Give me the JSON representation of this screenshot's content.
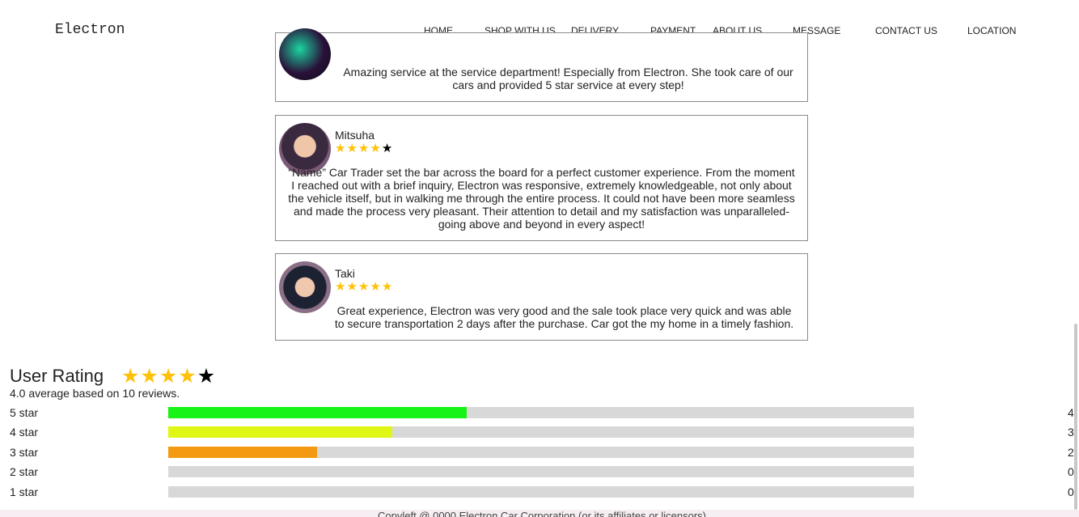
{
  "brand": "Electron",
  "nav": [
    "HOME",
    "SHOP WITH US",
    "DELIVERY",
    "PAYMENT",
    "ABOUT US",
    "MESSAGE",
    "CONTACT US",
    "LOCATION"
  ],
  "reviews": [
    {
      "name": "",
      "stars": null,
      "text": "Amazing service at the service department! Especially from Electron. She took care of our cars and provided 5 star service at every step!"
    },
    {
      "name": "Mitsuha",
      "stars": 4,
      "text": "“Name” Car Trader set the bar across the board for a perfect customer experience. From the moment I reached out with a brief inquiry, Electron was responsive, extremely knowledgeable, not only about the vehicle itself, but in walking me through the entire process. It could not have been more seamless and made the process very pleasant. Their attention to detail and my satisfaction was unparalleled- going above and beyond in every aspect!"
    },
    {
      "name": "Taki",
      "stars": 5,
      "text": "Great experience, Electron was very good and the sale took place very quick and was able to secure transportation 2 days after the purchase. Car got the my home in a timely fashion."
    }
  ],
  "rating": {
    "heading": "User Rating",
    "stars": 4,
    "summary": "4.0 average based on 10 reviews.",
    "rows": [
      {
        "label": "5 star",
        "count": "4",
        "fraction": 0.4,
        "color": "#17f217"
      },
      {
        "label": "4 star",
        "count": "3",
        "fraction": 0.3,
        "color": "#e0f714"
      },
      {
        "label": "3 star",
        "count": "2",
        "fraction": 0.2,
        "color": "#f39a12"
      },
      {
        "label": "2 star",
        "count": "0",
        "fraction": 0,
        "color": "#17f217"
      },
      {
        "label": "1 star",
        "count": "0",
        "fraction": 0,
        "color": "#17f217"
      }
    ]
  },
  "footer": "Copyleft @ 0000 Electron Car Corporation (or its affiliates or licensors)"
}
